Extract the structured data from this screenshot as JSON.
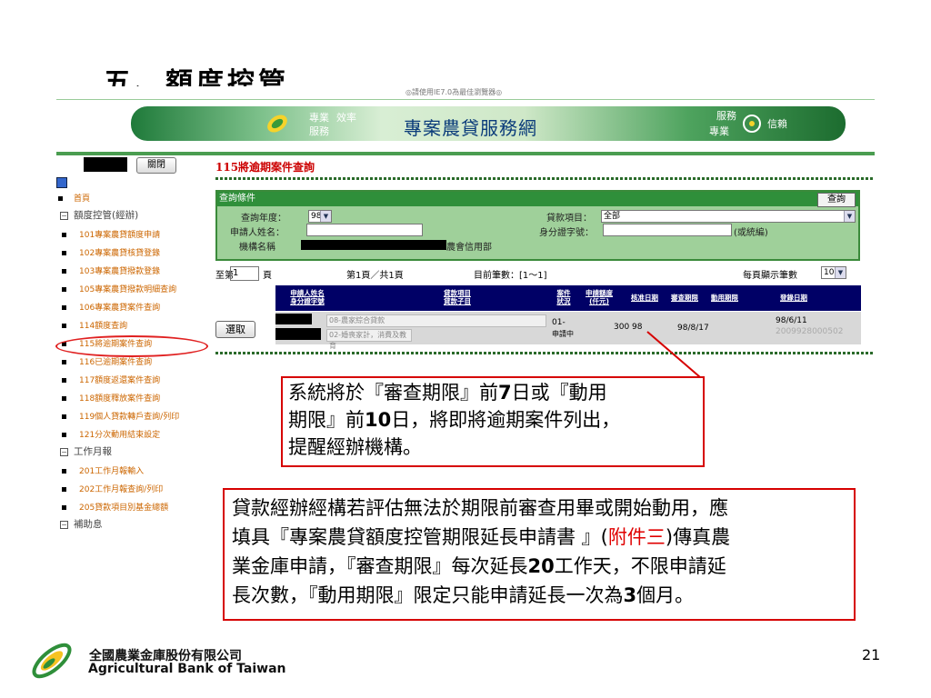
{
  "slide": {
    "title": "五、額度控管",
    "page_number": "21"
  },
  "app": {
    "top_notice": "◎請使用IE7.0為最佳瀏覽器◎",
    "banner": {
      "slogan_1": "專業",
      "slogan_2": "服務",
      "slogan_3": "效率",
      "title": "專案農貸服務網",
      "slogan_4": "服務",
      "slogan_5": "專業",
      "slogan_6": "信賴"
    },
    "sidebar": {
      "close_label": "關閉",
      "home_label": "首頁",
      "section_1": "額度控管(經辦)",
      "items_1": [
        "101專案農貸額度申請",
        "102專案農貸核貸登錄",
        "103專案農貸撥款登錄",
        "105專案農貸撥款明細查詢",
        "106專案農貸案件查詢",
        "114額度查詢",
        "115將逾期案件查詢",
        "116已逾期案件查詢",
        "117額度返還案件查詢",
        "118額度釋放案件查詢",
        "119個人貸款轉戶查詢/列印",
        "121分次動用結束設定"
      ],
      "section_2": "工作月報",
      "items_2": [
        "201工作月報輸入",
        "202工作月報查詢/列印",
        "205貸款項目別基金總額"
      ],
      "section_3": "補助息"
    },
    "main": {
      "heading": "115將逾期案件查詢",
      "query": {
        "header": "查詢條件",
        "button": "查詢",
        "year_label": "查詢年度：",
        "year_value": "98",
        "applicant_label": "申請人姓名：",
        "org_label": "機構名稱",
        "org_suffix": "農會信用部",
        "loan_item_label": "貸款項目：",
        "loan_item_value": "全部",
        "id_label": "身分證字號：",
        "id_hint": "(或統編)"
      },
      "pager": {
        "goto_prefix": "至第",
        "goto_value": "1",
        "goto_suffix": "頁",
        "page_info": "第1頁／共1頁",
        "count_label": "目前筆數：[1〜1]",
        "per_page_label": "每頁顯示筆數",
        "per_page_value": "10"
      },
      "table": {
        "headers": [
          "申請人姓名\n身分證字號",
          "貸款項目\n貸款子目",
          "案件\n狀況",
          "申請額度\n(仟元)",
          "核准日期",
          "審查期限",
          "動用期限",
          "登錄日期"
        ],
        "row": {
          "select_label": "選取",
          "loan_item": "08-農家綜合貸款",
          "loan_subitem": "02-婚喪家計，消費及教育",
          "status_code": "01-",
          "status_text": "申請中",
          "amount": "300",
          "approve_date_partial": "98",
          "review_deadline": "98/8/17",
          "register_date": "98/6/11",
          "register_no": "2009928000502"
        }
      }
    }
  },
  "callouts": {
    "c1_line1_a": "系統將於『審查期限』前",
    "c1_line1_b": "7",
    "c1_line1_c": "日或『動用",
    "c1_line2_a": "期限』前",
    "c1_line2_b": "10",
    "c1_line2_c": "日，將即將逾期案件列出，",
    "c1_line3": "提醒經辦機構。",
    "c2_line1": "貸款經辦經構若評估無法於期限前審查用畢或開始動用，應",
    "c2_line2_a": "填具『專案農貸額度控管期限延長申請書 』(",
    "c2_line2_red": "附件三",
    "c2_line2_b": ")傳真農",
    "c2_line3_a": "業金庫申請，『審查期限』每次延長",
    "c2_line3_b": "20",
    "c2_line3_c": "工作天，不限申請延",
    "c2_line4_a": "長次數，『動用期限』限定只能申請延長一次為",
    "c2_line4_b": "3",
    "c2_line4_c": "個月。"
  },
  "footer": {
    "company_cn": "全國農業金庫股份有限公司",
    "company_en": "Agricultural Bank of Taiwan"
  },
  "colors": {
    "callout_border": "#d60000",
    "table_header": "#000066",
    "query_panel": "#9fd09a",
    "accent_green": "#2f8f3a"
  }
}
